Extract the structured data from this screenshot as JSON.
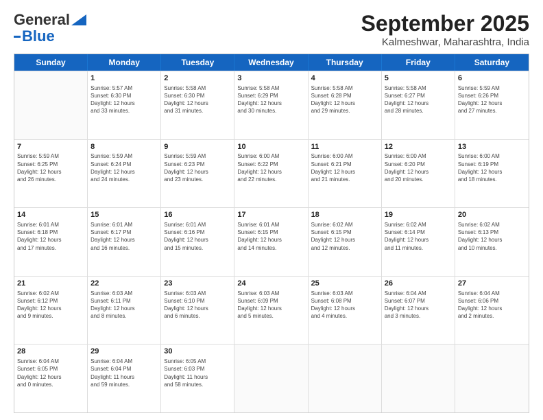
{
  "header": {
    "logo_general": "General",
    "logo_blue": "Blue",
    "title": "September 2025",
    "subtitle": "Kalmeshwar, Maharashtra, India"
  },
  "days": [
    "Sunday",
    "Monday",
    "Tuesday",
    "Wednesday",
    "Thursday",
    "Friday",
    "Saturday"
  ],
  "weeks": [
    [
      {
        "num": "",
        "info": ""
      },
      {
        "num": "1",
        "info": "Sunrise: 5:57 AM\nSunset: 6:30 PM\nDaylight: 12 hours\nand 33 minutes."
      },
      {
        "num": "2",
        "info": "Sunrise: 5:58 AM\nSunset: 6:30 PM\nDaylight: 12 hours\nand 31 minutes."
      },
      {
        "num": "3",
        "info": "Sunrise: 5:58 AM\nSunset: 6:29 PM\nDaylight: 12 hours\nand 30 minutes."
      },
      {
        "num": "4",
        "info": "Sunrise: 5:58 AM\nSunset: 6:28 PM\nDaylight: 12 hours\nand 29 minutes."
      },
      {
        "num": "5",
        "info": "Sunrise: 5:58 AM\nSunset: 6:27 PM\nDaylight: 12 hours\nand 28 minutes."
      },
      {
        "num": "6",
        "info": "Sunrise: 5:59 AM\nSunset: 6:26 PM\nDaylight: 12 hours\nand 27 minutes."
      }
    ],
    [
      {
        "num": "7",
        "info": "Sunrise: 5:59 AM\nSunset: 6:25 PM\nDaylight: 12 hours\nand 26 minutes."
      },
      {
        "num": "8",
        "info": "Sunrise: 5:59 AM\nSunset: 6:24 PM\nDaylight: 12 hours\nand 24 minutes."
      },
      {
        "num": "9",
        "info": "Sunrise: 5:59 AM\nSunset: 6:23 PM\nDaylight: 12 hours\nand 23 minutes."
      },
      {
        "num": "10",
        "info": "Sunrise: 6:00 AM\nSunset: 6:22 PM\nDaylight: 12 hours\nand 22 minutes."
      },
      {
        "num": "11",
        "info": "Sunrise: 6:00 AM\nSunset: 6:21 PM\nDaylight: 12 hours\nand 21 minutes."
      },
      {
        "num": "12",
        "info": "Sunrise: 6:00 AM\nSunset: 6:20 PM\nDaylight: 12 hours\nand 20 minutes."
      },
      {
        "num": "13",
        "info": "Sunrise: 6:00 AM\nSunset: 6:19 PM\nDaylight: 12 hours\nand 18 minutes."
      }
    ],
    [
      {
        "num": "14",
        "info": "Sunrise: 6:01 AM\nSunset: 6:18 PM\nDaylight: 12 hours\nand 17 minutes."
      },
      {
        "num": "15",
        "info": "Sunrise: 6:01 AM\nSunset: 6:17 PM\nDaylight: 12 hours\nand 16 minutes."
      },
      {
        "num": "16",
        "info": "Sunrise: 6:01 AM\nSunset: 6:16 PM\nDaylight: 12 hours\nand 15 minutes."
      },
      {
        "num": "17",
        "info": "Sunrise: 6:01 AM\nSunset: 6:15 PM\nDaylight: 12 hours\nand 14 minutes."
      },
      {
        "num": "18",
        "info": "Sunrise: 6:02 AM\nSunset: 6:15 PM\nDaylight: 12 hours\nand 12 minutes."
      },
      {
        "num": "19",
        "info": "Sunrise: 6:02 AM\nSunset: 6:14 PM\nDaylight: 12 hours\nand 11 minutes."
      },
      {
        "num": "20",
        "info": "Sunrise: 6:02 AM\nSunset: 6:13 PM\nDaylight: 12 hours\nand 10 minutes."
      }
    ],
    [
      {
        "num": "21",
        "info": "Sunrise: 6:02 AM\nSunset: 6:12 PM\nDaylight: 12 hours\nand 9 minutes."
      },
      {
        "num": "22",
        "info": "Sunrise: 6:03 AM\nSunset: 6:11 PM\nDaylight: 12 hours\nand 8 minutes."
      },
      {
        "num": "23",
        "info": "Sunrise: 6:03 AM\nSunset: 6:10 PM\nDaylight: 12 hours\nand 6 minutes."
      },
      {
        "num": "24",
        "info": "Sunrise: 6:03 AM\nSunset: 6:09 PM\nDaylight: 12 hours\nand 5 minutes."
      },
      {
        "num": "25",
        "info": "Sunrise: 6:03 AM\nSunset: 6:08 PM\nDaylight: 12 hours\nand 4 minutes."
      },
      {
        "num": "26",
        "info": "Sunrise: 6:04 AM\nSunset: 6:07 PM\nDaylight: 12 hours\nand 3 minutes."
      },
      {
        "num": "27",
        "info": "Sunrise: 6:04 AM\nSunset: 6:06 PM\nDaylight: 12 hours\nand 2 minutes."
      }
    ],
    [
      {
        "num": "28",
        "info": "Sunrise: 6:04 AM\nSunset: 6:05 PM\nDaylight: 12 hours\nand 0 minutes."
      },
      {
        "num": "29",
        "info": "Sunrise: 6:04 AM\nSunset: 6:04 PM\nDaylight: 11 hours\nand 59 minutes."
      },
      {
        "num": "30",
        "info": "Sunrise: 6:05 AM\nSunset: 6:03 PM\nDaylight: 11 hours\nand 58 minutes."
      },
      {
        "num": "",
        "info": ""
      },
      {
        "num": "",
        "info": ""
      },
      {
        "num": "",
        "info": ""
      },
      {
        "num": "",
        "info": ""
      }
    ]
  ]
}
